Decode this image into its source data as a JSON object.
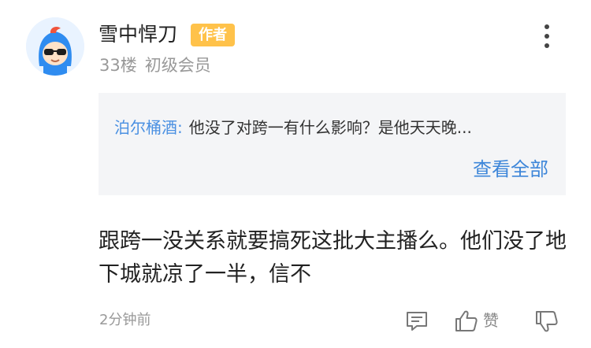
{
  "comment": {
    "user": {
      "name": "雪中悍刀",
      "badge": "作者",
      "floor": "33楼",
      "level": "初级会员",
      "avatar_icon": "sunglasses-cartoon-avatar"
    },
    "quote": {
      "user": "泊尔桶酒",
      "separator": ":",
      "text": "他没了对跨一有什么影响？是他天天晚...",
      "view_all": "查看全部"
    },
    "text": "跟跨一没关系就要搞死这批大主播么。他们没了地下城就凉了一半，信不",
    "time": "2分钟前",
    "actions": {
      "like_label": "赞",
      "reply_icon": "reply-comment-icon",
      "like_icon": "thumbs-up-icon",
      "dislike_icon": "thumbs-down-icon",
      "more_icon": "more-vertical-icon"
    }
  },
  "colors": {
    "badge": "#ffc24a",
    "link": "#3d86d9",
    "quote_bg": "#f4f5f7",
    "muted": "#999999"
  }
}
